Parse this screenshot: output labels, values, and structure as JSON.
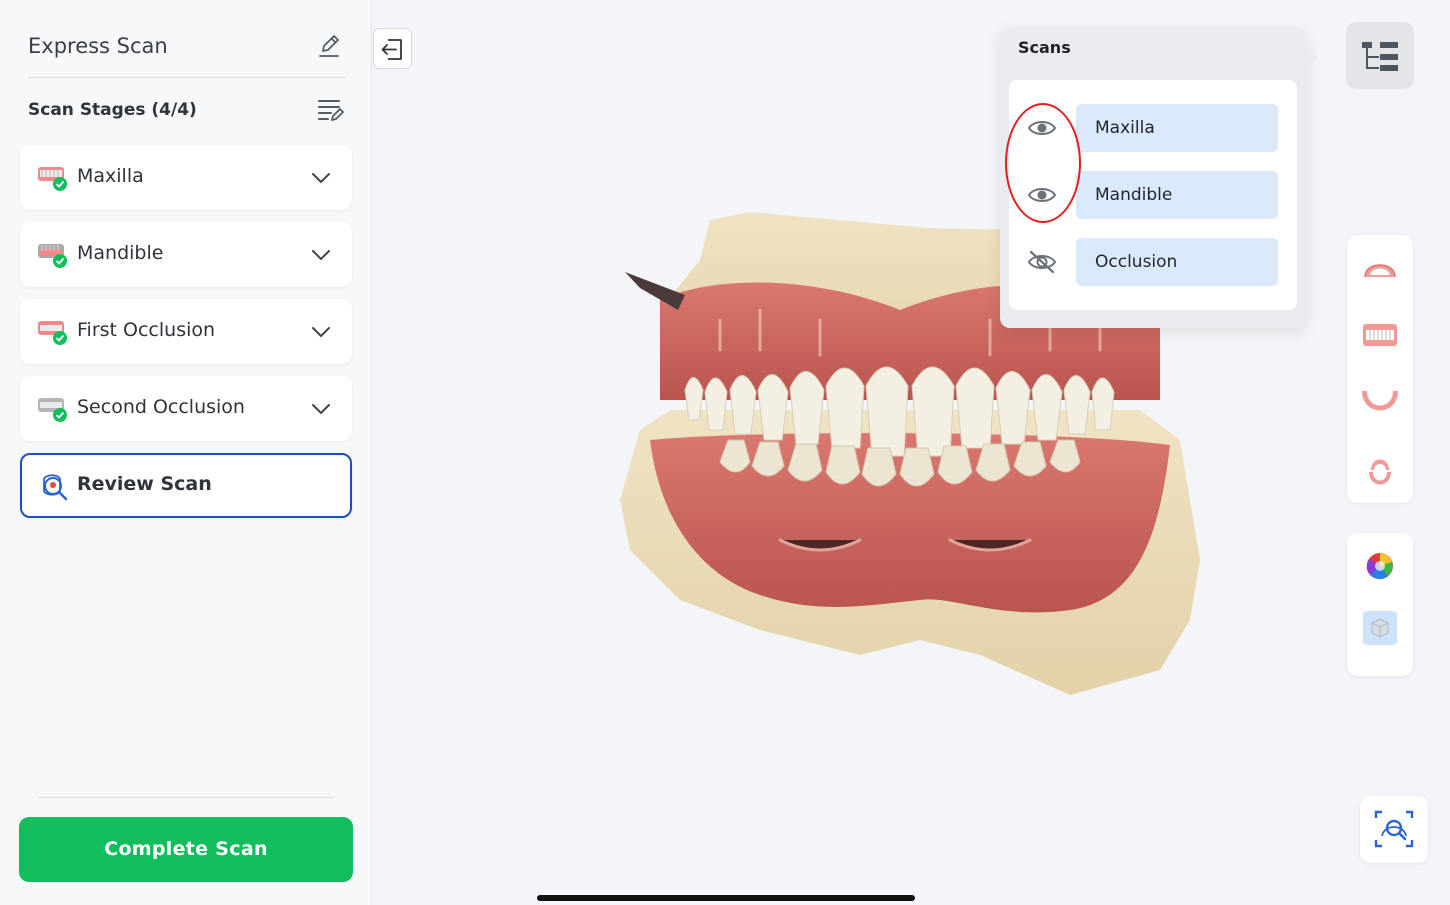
{
  "sidebar": {
    "title": "Express Scan",
    "stages_title": "Scan Stages (4/4)",
    "stages": [
      {
        "label": "Maxilla",
        "status": "complete"
      },
      {
        "label": "Mandible",
        "status": "complete"
      },
      {
        "label": "First Occlusion",
        "status": "complete"
      },
      {
        "label": "Second Occlusion",
        "status": "complete"
      }
    ],
    "review": {
      "label": "Review Scan",
      "selected": true
    },
    "complete_button": "Complete Scan"
  },
  "scans_panel": {
    "title": "Scans",
    "items": [
      {
        "label": "Maxilla",
        "visible": true,
        "icon": "eye-icon"
      },
      {
        "label": "Mandible",
        "visible": true,
        "icon": "eye-icon"
      },
      {
        "label": "Occlusion",
        "visible": false,
        "icon": "eye-off-icon"
      }
    ]
  },
  "right_tools": {
    "view_buttons": [
      "maxilla-view-icon",
      "front-view-icon",
      "mandible-view-icon",
      "occlusal-view-icon"
    ],
    "texture_buttons": [
      "color-texture-icon",
      "mono-texture-icon"
    ],
    "tree_button": "scan-tree-icon",
    "zoom_button": "zoom-fit-icon"
  },
  "colors": {
    "accent_blue": "#1f4fbf",
    "success_green": "#12bd5c",
    "pill_blue": "#dbe9fd",
    "annotation_red": "#e02020"
  }
}
